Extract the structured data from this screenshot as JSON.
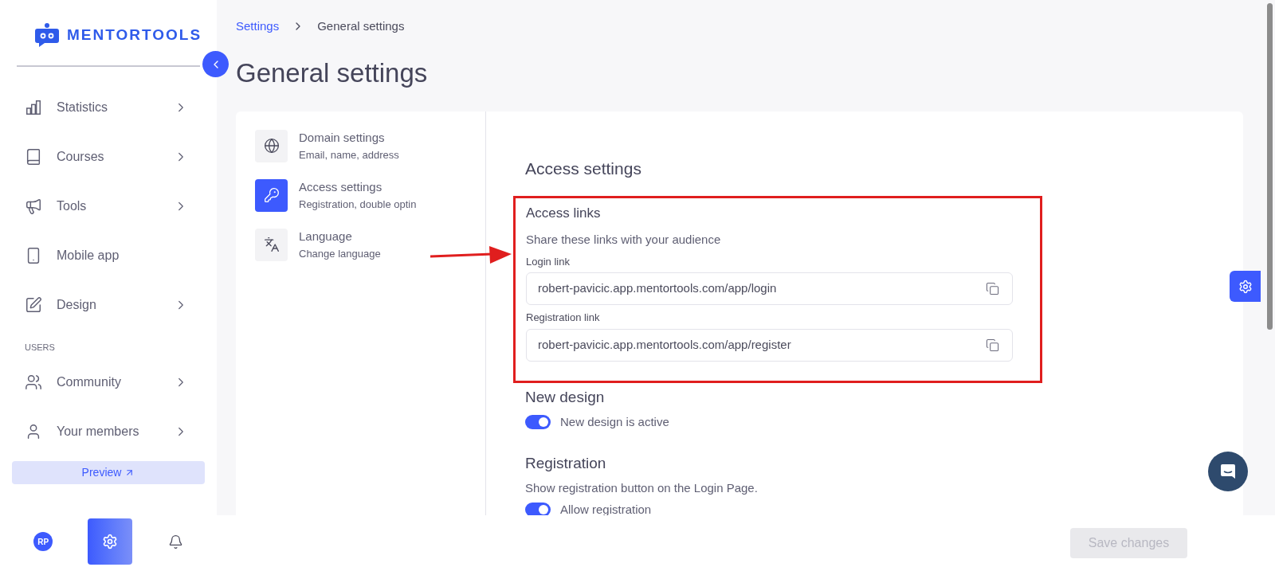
{
  "sidebar": {
    "logo": "MENTORTOOLS",
    "groups": [
      {
        "items": [
          {
            "label": "Statistics",
            "expandable": true
          },
          {
            "label": "Courses",
            "expandable": true
          },
          {
            "label": "Tools",
            "expandable": true
          },
          {
            "label": "Mobile app",
            "expandable": false
          },
          {
            "label": "Design",
            "expandable": true
          }
        ]
      },
      {
        "heading": "USERS",
        "items": [
          {
            "label": "Community",
            "expandable": true
          },
          {
            "label": "Your members",
            "expandable": true
          }
        ]
      }
    ],
    "preview_button": "Preview",
    "footer": {
      "avatar": "RP",
      "settings_selected": true
    }
  },
  "breadcrumb": [
    {
      "label": "Settings",
      "link": true
    },
    {
      "label": "General settings",
      "link": false
    }
  ],
  "title": "General settings",
  "settings_nav": [
    {
      "title": "Domain settings",
      "subtitle": "Email, name, address",
      "selected": false
    },
    {
      "title": "Access settings",
      "subtitle": "Registration, double optin",
      "selected": true
    },
    {
      "title": "Language",
      "subtitle": "Change language",
      "selected": false
    }
  ],
  "content": {
    "heading": "Access settings",
    "access_links": {
      "title": "Access links",
      "description": "Share these links with your audience",
      "highlighted": true,
      "fields": [
        {
          "label": "Login link",
          "value": "robert-pavicic.app.mentortools.com/app/login"
        },
        {
          "label": "Registration link",
          "value": "robert-pavicic.app.mentortools.com/app/register"
        }
      ]
    },
    "new_design": {
      "title": "New design",
      "toggle": {
        "label": "New design is active",
        "on": true
      }
    },
    "registration": {
      "title": "Registration",
      "description": "Show registration button on the Login Page.",
      "toggle": {
        "label": "Allow registration",
        "on": true
      }
    }
  },
  "save_button": {
    "label": "Save changes",
    "disabled": true
  }
}
